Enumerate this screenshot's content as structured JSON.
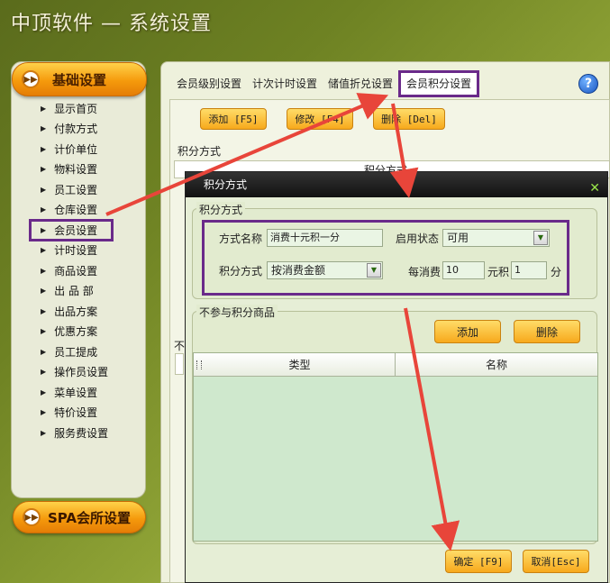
{
  "window": {
    "title": "中顶软件 — 系统设置"
  },
  "sidebar": {
    "header_label": "基础设置",
    "items": [
      {
        "label": "显示首页"
      },
      {
        "label": "付款方式"
      },
      {
        "label": "计价单位"
      },
      {
        "label": "物料设置"
      },
      {
        "label": "员工设置"
      },
      {
        "label": "仓库设置"
      },
      {
        "label": "会员设置"
      },
      {
        "label": "计时设置"
      },
      {
        "label": "商品设置"
      },
      {
        "label": "出 品 部"
      },
      {
        "label": "出品方案"
      },
      {
        "label": "优惠方案"
      },
      {
        "label": "员工提成"
      },
      {
        "label": "操作员设置"
      },
      {
        "label": "菜单设置"
      },
      {
        "label": "特价设置"
      },
      {
        "label": "服务费设置"
      }
    ],
    "spa_button": "SPA会所设置"
  },
  "tabs": [
    {
      "label": "会员级别设置"
    },
    {
      "label": "计次计时设置"
    },
    {
      "label": "储值折兑设置"
    },
    {
      "label": "会员积分设置"
    }
  ],
  "toolbar": {
    "add": "添加 [F5]",
    "edit": "修改 [F4]",
    "delete": "删除 [Del]"
  },
  "background": {
    "section_label": "积分方式",
    "table_header": "积分方式",
    "section2_label": "不"
  },
  "dialog": {
    "title": "积分方式",
    "group1_label": "积分方式",
    "method_name_label": "方式名称",
    "method_name_value": "消费十元积一分",
    "enabled_label": "启用状态",
    "enabled_value": "可用",
    "mode_label": "积分方式",
    "mode_value": "按消费金额",
    "per_label": "每消费",
    "per_value": "10",
    "yuan_label": "元积",
    "points_value": "1",
    "fen_label": "分",
    "group2_label": "不参与积分商品",
    "add_button": "添加",
    "delete_button": "删除",
    "table_columns": [
      "类型",
      "名称"
    ],
    "ok_button": "确定 [F9]",
    "cancel_button": "取消[Esc]"
  },
  "colors": {
    "accent_orange": "#f59a0c",
    "highlight_purple": "#6a2a8a",
    "arrow_red": "#e8453a"
  }
}
